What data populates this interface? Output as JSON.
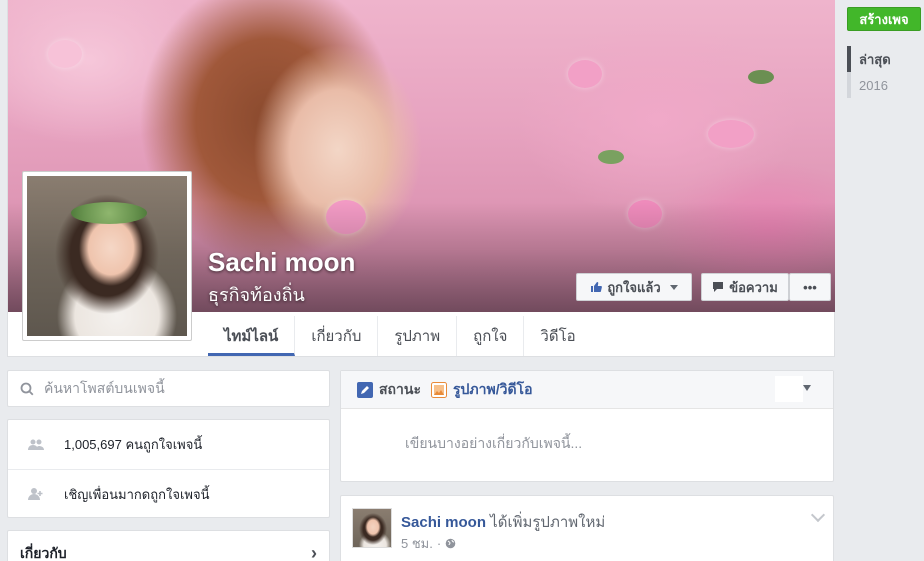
{
  "page": {
    "name": "Sachi moon",
    "category": "ธุรกิจท้องถิ่น"
  },
  "actions": {
    "liked_label": "ถูกใจแล้ว",
    "message_label": "ข้อความ",
    "more_label": "•••"
  },
  "tabs": [
    {
      "label": "ไทม์ไลน์",
      "active": true
    },
    {
      "label": "เกี่ยวกับ",
      "active": false
    },
    {
      "label": "รูปภาพ",
      "active": false
    },
    {
      "label": "ถูกใจ",
      "active": false
    },
    {
      "label": "วิดีโอ",
      "active": false
    }
  ],
  "search": {
    "placeholder": "ค้นหาโพสต์บนเพจนี้"
  },
  "info": {
    "likes_text": "1,005,697 คนถูกใจเพจนี้",
    "invite_text": "เชิญเพื่อนมากดถูกใจเพจนี้"
  },
  "about": {
    "title": "เกี่ยวกับ",
    "chevron": "›"
  },
  "composer": {
    "status_label": "สถานะ",
    "photo_label": "รูปภาพ/วิดีโอ",
    "placeholder": "เขียนบางอย่างเกี่ยวกับเพจนี้..."
  },
  "post": {
    "author": "Sachi moon",
    "action": " ได้เพิ่มรูปภาพใหม่",
    "time": "5 ชม.",
    "sep": "·"
  },
  "rail": {
    "create_page_label": "สร้างเพจ",
    "items": [
      {
        "label": "ล่าสุด",
        "active": true
      },
      {
        "label": "2016",
        "active": false
      }
    ]
  },
  "colors": {
    "brand_blue": "#4267b2",
    "link_blue": "#365899",
    "green": "#42b72a",
    "bg": "#e9ebee"
  }
}
